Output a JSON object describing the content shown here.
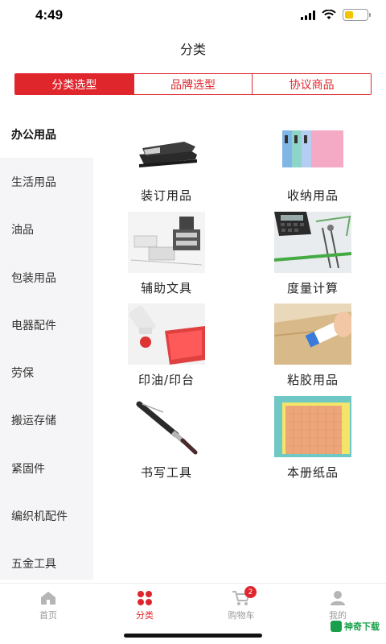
{
  "status_bar": {
    "time": "4:49"
  },
  "header": {
    "title": "分类"
  },
  "segments": [
    {
      "label": "分类选型",
      "active": true
    },
    {
      "label": "品牌选型",
      "active": false
    },
    {
      "label": "协议商品",
      "active": false
    }
  ],
  "sidebar": {
    "items": [
      {
        "label": "办公用品",
        "active": true
      },
      {
        "label": "生活用品"
      },
      {
        "label": "油品"
      },
      {
        "label": "包装用品"
      },
      {
        "label": "电器配件"
      },
      {
        "label": "劳保"
      },
      {
        "label": "搬运存储"
      },
      {
        "label": "紧固件"
      },
      {
        "label": "编织机配件"
      },
      {
        "label": "五金工具"
      }
    ]
  },
  "grid": {
    "items": [
      {
        "label": "装订用品",
        "icon": "stapler-image"
      },
      {
        "label": "收纳用品",
        "icon": "folders-image"
      },
      {
        "label": "辅助文具",
        "icon": "stamps-image"
      },
      {
        "label": "度量计算",
        "icon": "calculator-image"
      },
      {
        "label": "印油/印台",
        "icon": "ink-pad-image"
      },
      {
        "label": "粘胶用品",
        "icon": "glue-image"
      },
      {
        "label": "书写工具",
        "icon": "pen-image"
      },
      {
        "label": "本册纸品",
        "icon": "notebook-image"
      }
    ]
  },
  "tabbar": {
    "items": [
      {
        "label": "首页",
        "icon": "home-icon",
        "active": false
      },
      {
        "label": "分类",
        "icon": "grid-icon",
        "active": true
      },
      {
        "label": "购物车",
        "icon": "cart-icon",
        "active": false,
        "badge": "2"
      },
      {
        "label": "我的",
        "icon": "user-icon",
        "active": false
      }
    ]
  },
  "watermark": {
    "text": "神奇下载"
  },
  "colors": {
    "accent": "#e0262d",
    "sidebar_bg": "#f5f5f7"
  }
}
